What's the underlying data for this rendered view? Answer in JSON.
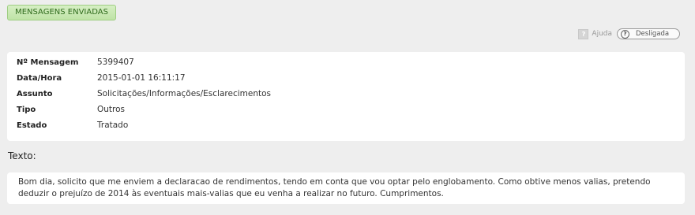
{
  "header": {
    "tab_label": "MENSAGENS ENVIADAS"
  },
  "help": {
    "icon": "question-icon",
    "label": "Ajuda",
    "toggle_icon": "?",
    "toggle_state": "Desligada"
  },
  "details": {
    "rows": [
      {
        "label": "Nº Mensagem",
        "value": "5399407"
      },
      {
        "label": "Data/Hora",
        "value": "2015-01-01 16:11:17"
      },
      {
        "label": "Assunto",
        "value": "Solicitações/Informações/Esclarecimentos"
      },
      {
        "label": "Tipo",
        "value": "Outros"
      },
      {
        "label": "Estado",
        "value": "Tratado"
      }
    ]
  },
  "message": {
    "heading": "Texto:",
    "body": "Bom dia, solicito que me enviem a declaracao de rendimentos, tendo em conta que vou optar pelo englobamento. Como obtive menos valias, pretendo deduzir o prejuízo de 2014 às eventuais mais-valias que eu venha a realizar no futuro. Cumprimentos."
  },
  "colors": {
    "page_background": "#eeeeee",
    "tab_background": "#c8e8b2",
    "tab_text": "#2f6b1c",
    "panel_background": "#ffffff"
  }
}
